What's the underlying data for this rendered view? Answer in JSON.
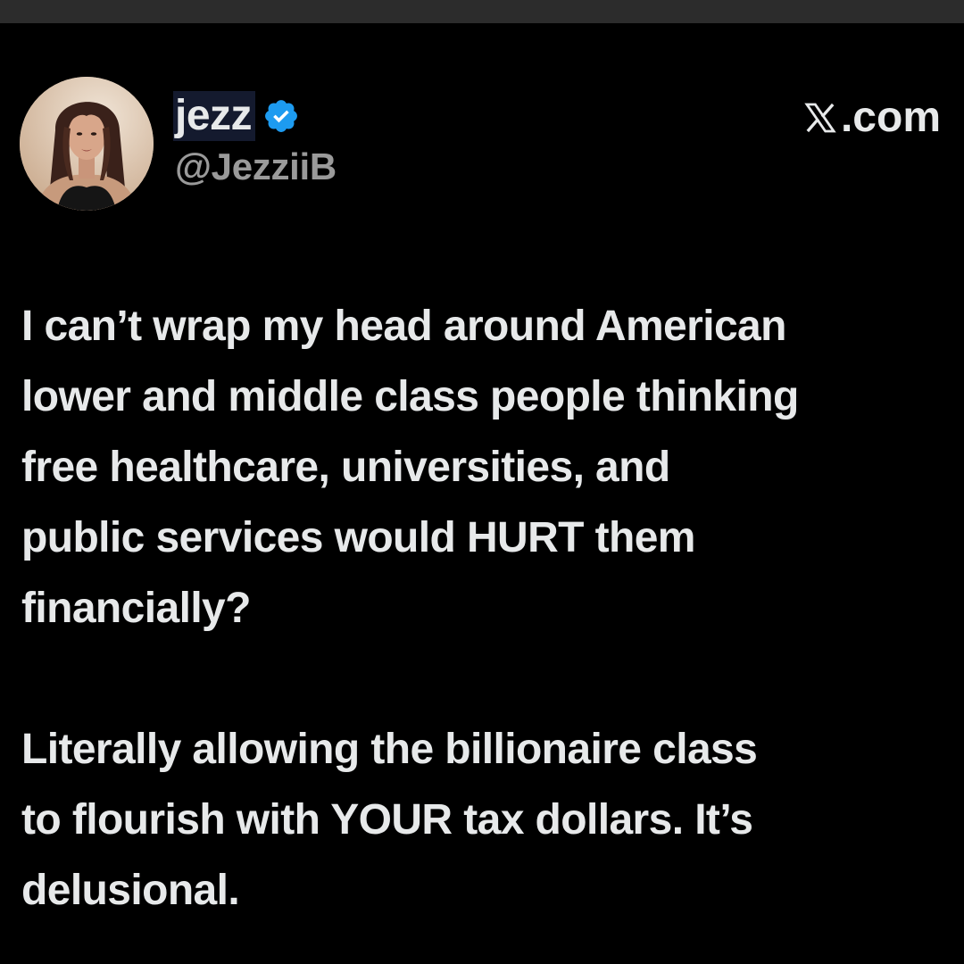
{
  "post": {
    "author": {
      "display_name": "jezz",
      "handle": "@JezziiB",
      "verified": true,
      "avatar_icon": "avatar-photo-icon",
      "badge_icon": "verified-badge-icon"
    },
    "brand": {
      "text": ".com",
      "icon": "x-logo-icon"
    },
    "paragraph1_lines": [
      "I can’t wrap my head around American",
      "lower and middle class people thinking",
      "free healthcare, universities, and",
      "public services would HURT them",
      "financially?"
    ],
    "paragraph2_lines": [
      "Literally allowing the billionaire class",
      "to flourish with YOUR tax dollars. It’s",
      "delusional."
    ]
  },
  "colors": {
    "background": "#000000",
    "text": "#e7e9ea",
    "handle": "#9a9a9a",
    "verified_blue": "#1d9bf0",
    "top_bar": "#2c2c2c"
  }
}
